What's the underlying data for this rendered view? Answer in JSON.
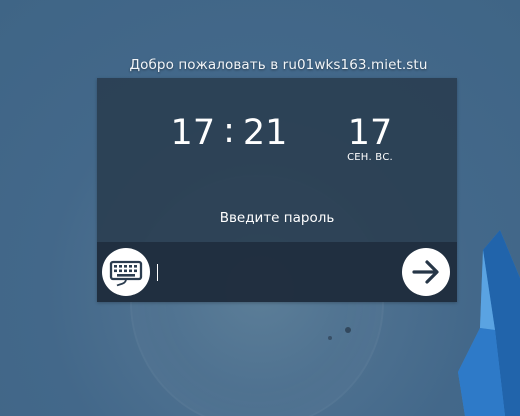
{
  "welcome": {
    "prefix": "Добро пожаловать в",
    "host": "ru01wks163.miet.stu"
  },
  "clock": {
    "hour": "17",
    "minute": "21",
    "day": "17",
    "weekday": "СЕН. ВС."
  },
  "login": {
    "prompt": "Введите пароль",
    "password": ""
  },
  "icons": {
    "keyboard": "keyboard-icon",
    "submit": "arrow-right-icon"
  }
}
